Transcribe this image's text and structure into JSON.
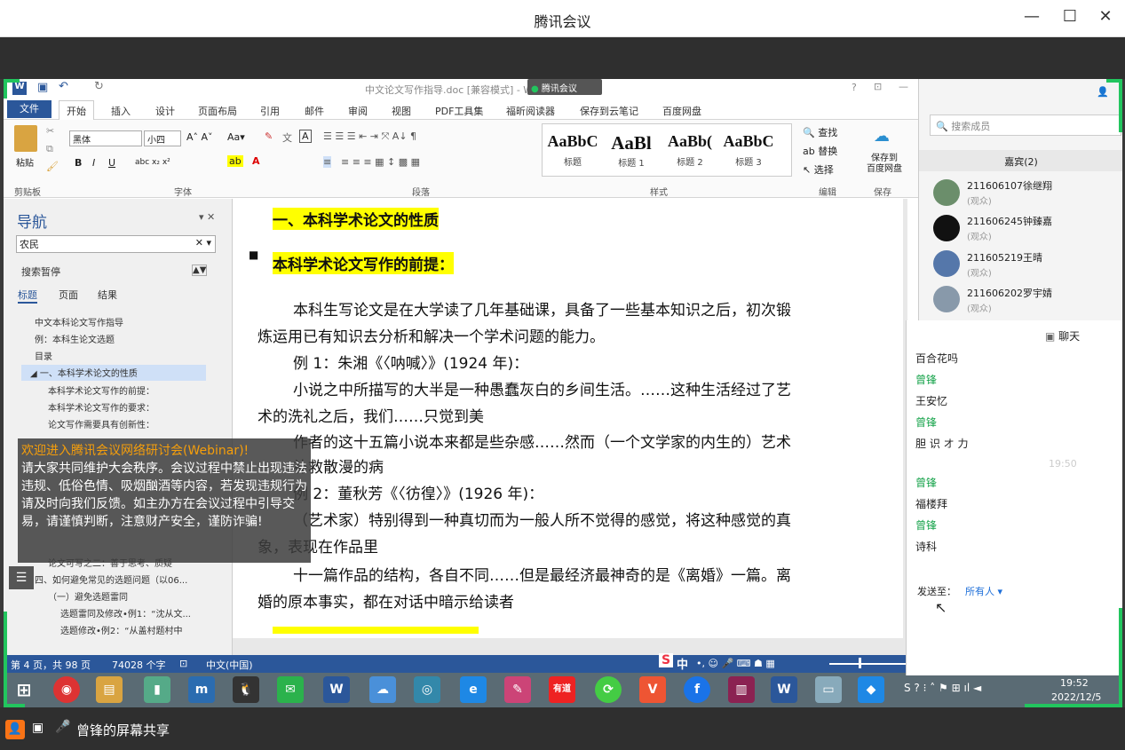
{
  "window": {
    "title": "腾讯会议"
  },
  "word": {
    "doc_title": "中文论文写作指导.doc [兼容模式] - Word",
    "meeting_badge": "腾讯会议",
    "tabs": [
      "文件",
      "开始",
      "插入",
      "设计",
      "页面布局",
      "引用",
      "邮件",
      "审阅",
      "视图",
      "PDF工具集",
      "福昕阅读器",
      "保存到云笔记",
      "百度网盘"
    ],
    "ribbon": {
      "paste": "粘贴",
      "clipboard": "剪贴板",
      "font_name": "黑体",
      "font_size": "小四",
      "font_group": "字体",
      "para_group": "段落",
      "style_group": "样式",
      "edit_group": "编辑",
      "save_group": "保存",
      "styles": [
        {
          "sample": "AaBbC",
          "label": "标题"
        },
        {
          "sample": "AaBl",
          "label": "标题 1"
        },
        {
          "sample": "AaBb(",
          "label": "标题 2"
        },
        {
          "sample": "AaBbC",
          "label": "标题 3"
        }
      ],
      "find": "查找",
      "replace": "替换",
      "select": "选择",
      "save_cloud": "保存到\n百度网盘"
    },
    "nav": {
      "title": "导航",
      "search_value": "农民",
      "search_paused": "搜索暂停",
      "tabs": [
        "标题",
        "页面",
        "结果"
      ],
      "items": [
        "中文本科论文写作指导",
        "例：本科生论文选题",
        "目录",
        "一、本科学术论文的性质",
        "本科学术论文写作的前提：",
        "本科学术论文写作的要求：",
        "论文写作需要具有创新性：",
        "论文可写之二：善于思考、质疑",
        "四、如何避免常见的选题问题（以06...",
        "（一）避免选题雷同",
        "选题雷同及修改•例1：“沈从文...",
        "选题修改•例2：“从盖村题村中"
      ]
    },
    "doc": {
      "h1": "一、本科学术论文的性质",
      "h2": "本科学术论文写作的前提：",
      "paras": [
        "本科生写论文是在大学读了几年基础课，具备了一些基本知识之后，初次锻",
        "炼运用已有知识去分析和解决一个学术问题的能力。",
        "例 1：朱湘《〈呐喊〉》(1924 年)：",
        "小说之中所描写的大半是一种愚蠢灰白的乡间生活。……这种生活经过了艺",
        "术的洗礼之后，我们……只觉到美",
        "作者的这十五篇小说本来都是些杂感……然而（一个文学家的内生的）艺术",
        "补救散漫的病",
        "例 2：董秋芳《〈彷徨〉》(1926 年)：",
        "（艺术家）特别得到一种真切而为一般人所不觉得的感觉，将这种感觉的真",
        "象，表现在作品里",
        "十一篇作品的结构，各自不同……但是最经济最神奇的是《离婚》一篇。离",
        "婚的原本事实，都在对话中暗示给读者"
      ]
    },
    "status": {
      "page": "第 4 页，共 98 页",
      "words": "74028 个字",
      "lang": "中文(中国)"
    },
    "ime": "中"
  },
  "taskbar": {
    "time": "19:52",
    "date": "2022/12/5",
    "icons": [
      "windows-start",
      "chrome",
      "file-explorer",
      "app-green",
      "app-m",
      "qq",
      "wechat",
      "word",
      "baidu-netdisk",
      "app-search",
      "ie",
      "app-paint",
      "youdao",
      "app-green-circle",
      "app-v",
      "app-f",
      "winrar",
      "word2",
      "app-folder",
      "tencent-meeting"
    ]
  },
  "members": {
    "search_placeholder": "搜索成员",
    "guest_header": "嘉宾(2)",
    "list": [
      {
        "name": "211606107徐继翔",
        "role": "(观众)",
        "color": "#6b8e6b"
      },
      {
        "name": "211606245钟臻嘉",
        "role": "(观众)",
        "color": "#111111"
      },
      {
        "name": "211605219王晴",
        "role": "(观众)",
        "color": "#5577aa"
      },
      {
        "name": "211606202罗宇婧",
        "role": "(观众)",
        "color": "#8899aa"
      }
    ]
  },
  "chat": {
    "title": "聊天",
    "messages": [
      {
        "text": "百合花吗",
        "sender": false
      },
      {
        "text": "曾锋",
        "sender": true
      },
      {
        "text": "王安忆",
        "sender": false
      },
      {
        "text": "曾锋",
        "sender": true
      },
      {
        "text": "胆 识 オ 力",
        "sender": false
      },
      {
        "text": "19:50",
        "time": true
      },
      {
        "text": "曾锋",
        "sender": true
      },
      {
        "text": "福楼拜",
        "sender": false
      },
      {
        "text": "曾锋",
        "sender": true
      },
      {
        "text": "诗科",
        "sender": false
      }
    ],
    "send_to": "发送至：",
    "recipient": "所有人"
  },
  "notice": {
    "title": "欢迎进入腾讯会议网络研讨会(Webinar)!",
    "body": "请大家共同维护大会秩序。会议过程中禁止出现违法违规、低俗色情、吸烟酗酒等内容，若发现违规行为请及时向我们反馈。如主办方在会议过程中引导交易，请谨慎判断，注意财产安全，谨防诈骗!"
  },
  "share_bar": {
    "label": "曾锋的屏幕共享"
  }
}
